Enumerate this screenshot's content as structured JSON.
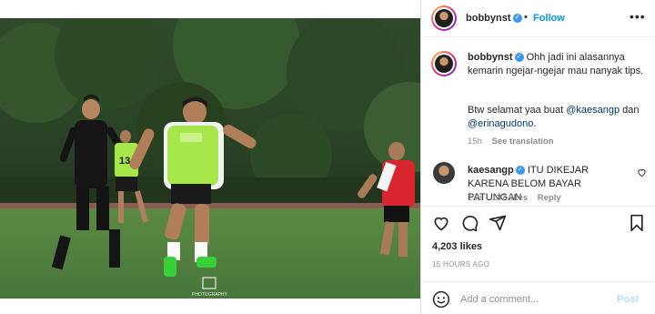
{
  "post": {
    "author": "bobbynst",
    "follow_label": "Follow",
    "dot": "•",
    "more_icon": "•••",
    "photo_watermark": "PHOTOGRAPHY"
  },
  "caption": {
    "username": "bobbynst",
    "text_1": "Ohh jadi ini alasannya kemarin ngejar-ngejar mau nanyak tips.",
    "text_2_prefix": "Btw selamat yaa buat ",
    "mention_1": "@kaesangp",
    "text_2_mid": " dan ",
    "mention_2": "@erinagudono",
    "text_2_suffix": ".",
    "age": "15h",
    "see_translation": "See translation"
  },
  "reply": {
    "username": "kaesangp",
    "text": "ITU DIKEJAR KARENA BELOM BAYAR PATUNGAN",
    "age": "13h",
    "likes": "137 likes",
    "reply_label": "Reply"
  },
  "stats": {
    "likes": "4,203 likes",
    "time": "15 HOURS AGO"
  },
  "composer": {
    "placeholder": "Add a comment...",
    "post_label": "Post"
  },
  "colors": {
    "accent": "#0095f6",
    "verified": "#3897f0",
    "muted": "#8e8e8e",
    "jersey_lime": "#a6e84a",
    "jersey_red": "#d9252f",
    "grass": "#4c7b3a"
  },
  "icons": [
    "verified-icon",
    "more-icon",
    "heart-icon",
    "comment-icon",
    "share-icon",
    "bookmark-icon",
    "emoji-icon",
    "heart-small-icon"
  ]
}
